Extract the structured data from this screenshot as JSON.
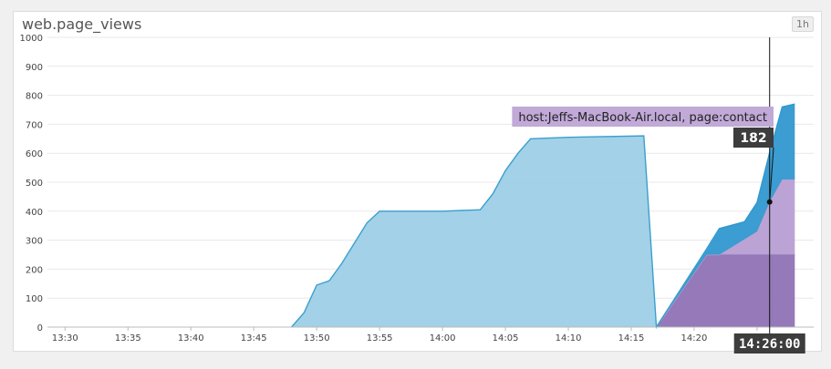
{
  "panel": {
    "title": "web.page_views",
    "range_button": "1h"
  },
  "tooltip": {
    "series_label": "host:Jeffs-MacBook-Air.local, page:contact",
    "value": "182",
    "time": "14:26:00"
  },
  "colors": {
    "series_blue_fill": "#9ecfe6",
    "series_blue_line": "#3a9fd0",
    "series_blue_dark": "#3098cf",
    "series_purple_light": "#b79fd3",
    "series_purple_dark": "#8f72b5",
    "tooltip_bg": "#c1a9d8",
    "value_bg": "#3d3d3d"
  },
  "chart_data": {
    "type": "area",
    "stacked": true,
    "ylim": [
      0,
      1000
    ],
    "yticks": [
      0,
      100,
      200,
      300,
      400,
      500,
      600,
      700,
      800,
      900,
      1000
    ],
    "xticks": [
      "13:30",
      "13:35",
      "13:40",
      "13:45",
      "13:50",
      "13:55",
      "14:00",
      "14:05",
      "14:10",
      "14:15",
      "14:20",
      "14:25"
    ],
    "xlim_minutes_from_1330": [
      -1.4,
      59.5
    ],
    "grid": true,
    "legend": "none",
    "series": [
      {
        "color": "#8f72b5",
        "x": [
          "14:17",
          "14:21",
          "14:22",
          "14:28"
        ],
        "y": [
          0,
          250,
          250,
          250
        ]
      },
      {
        "color": "#b79fd3",
        "x": [
          "14:17",
          "14:21",
          "14:22",
          "14:25",
          "14:26",
          "14:27",
          "14:28"
        ],
        "y": [
          0,
          0,
          0,
          80,
          182,
          260,
          260
        ]
      },
      {
        "color": "#3098cf",
        "x": [
          "14:17",
          "14:21",
          "14:22",
          "14:24",
          "14:25",
          "14:26",
          "14:27",
          "14:28"
        ],
        "y": [
          0,
          20,
          90,
          60,
          100,
          170,
          250,
          260
        ]
      },
      {
        "color": "#9ecfe6",
        "x": [
          "13:48",
          "13:49",
          "13:50",
          "13:51",
          "13:52",
          "13:53",
          "13:54",
          "13:55",
          "13:56",
          "14:00",
          "14:03",
          "14:04",
          "14:05",
          "14:06",
          "14:07",
          "14:10",
          "14:16",
          "14:17",
          "14:22"
        ],
        "y": [
          0,
          50,
          145,
          160,
          220,
          290,
          360,
          400,
          400,
          400,
          405,
          460,
          540,
          600,
          650,
          655,
          660,
          0,
          0
        ]
      }
    ]
  }
}
